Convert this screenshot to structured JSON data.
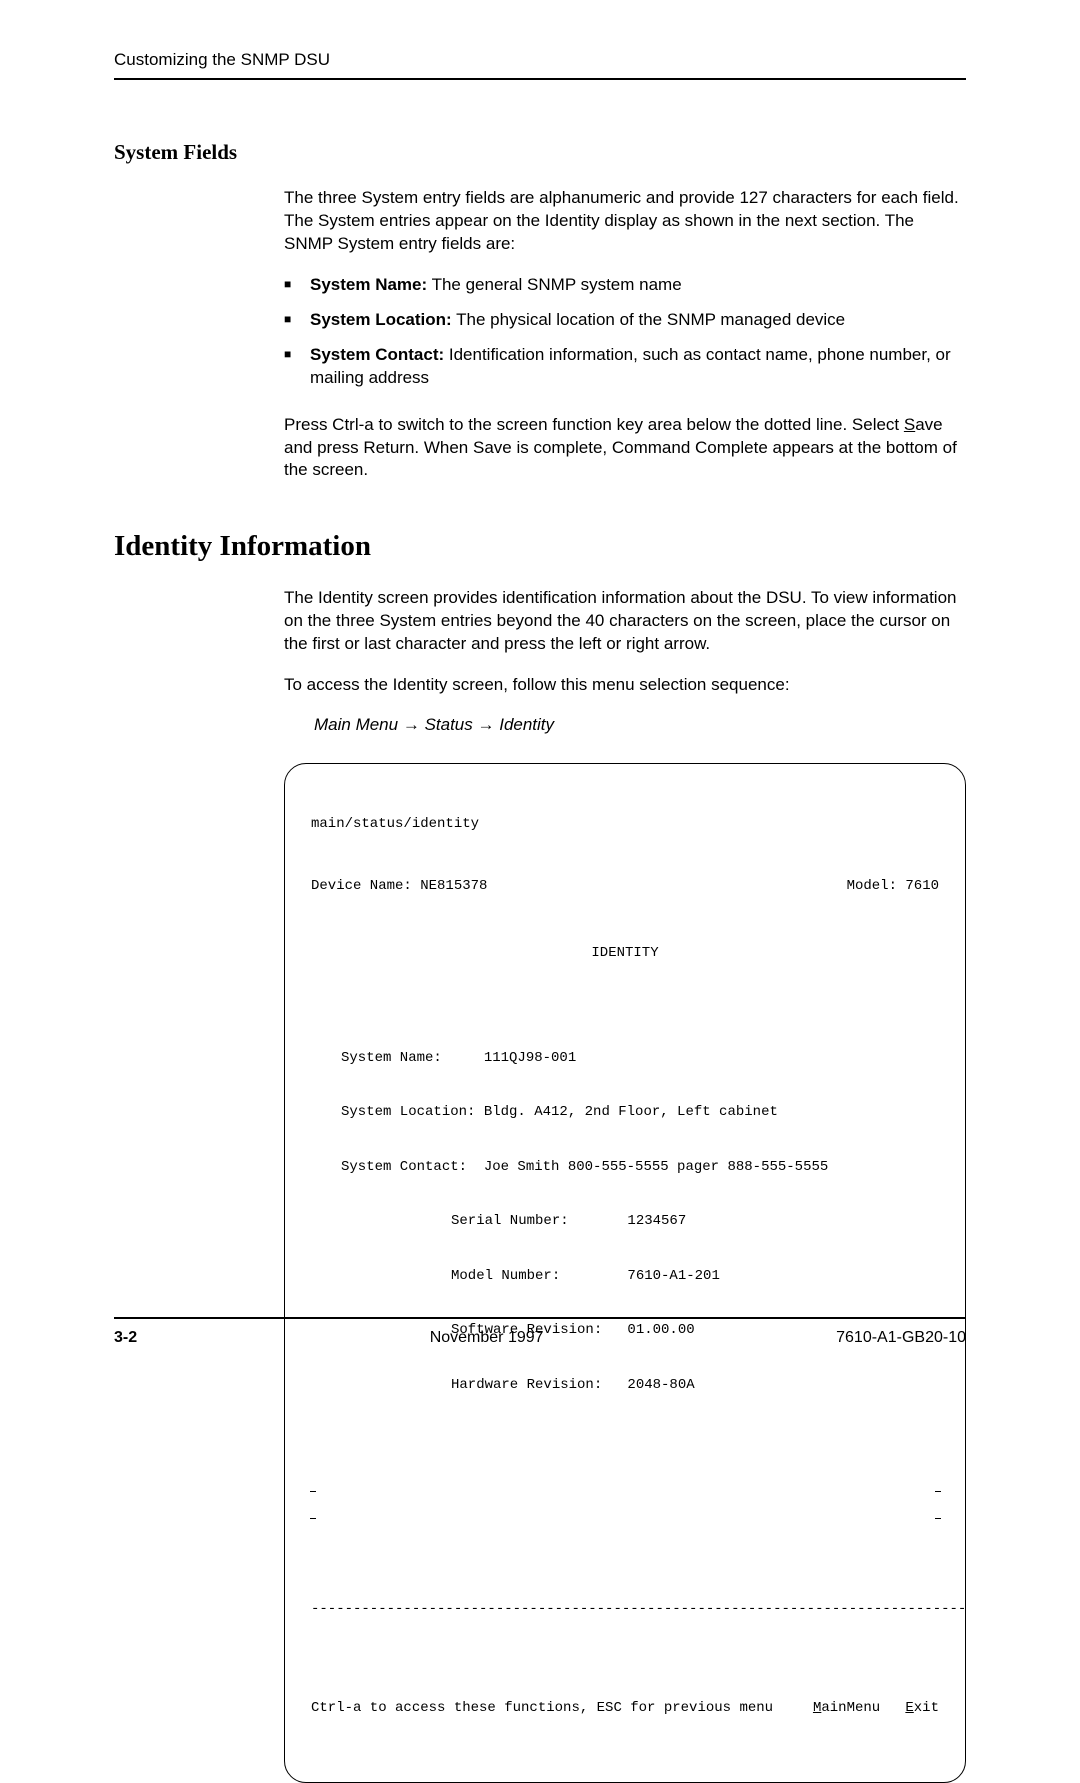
{
  "header": "Customizing the SNMP DSU",
  "section1": {
    "title": "System Fields",
    "intro": "The three System entry fields are alphanumeric and provide 127 characters for each field. The System entries appear on the Identity display as shown in the next section. The SNMP System entry fields are:",
    "bullets": [
      {
        "bold": "System Name:",
        "rest": " The general SNMP system name"
      },
      {
        "bold": "System Location:",
        "rest": " The physical location of the SNMP managed device"
      },
      {
        "bold": "System Contact:",
        "rest": " Identification information, such as contact name, phone number, or mailing address"
      }
    ],
    "after_pre": "Press Ctrl-a to switch to the screen function key area below the dotted line. Select ",
    "after_underline": "S",
    "after_post": "ave and press Return. When Save is complete, Command Complete appears at the bottom of the screen."
  },
  "section2": {
    "title": "Identity Information",
    "p1": "The Identity screen provides identification information about the DSU. To view information on the three System entries beyond the 40 characters on the screen, place the cursor on the first or last character and press the left or right arrow.",
    "p2": "To access the Identity screen, follow this menu selection sequence:",
    "path": {
      "a": "Main Menu ",
      "b": "Status ",
      "c": "Identity"
    }
  },
  "terminal": {
    "breadcrumb": "main/status/identity",
    "device_name": "Device Name: NE815378",
    "model": "Model: 7610",
    "title": "IDENTITY",
    "sys_name": "System Name:     111QJ98-001",
    "sys_loc": "System Location: Bldg. A412, 2nd Floor, Left cabinet",
    "sys_contact": "System Contact:  Joe Smith 800-555-5555 pager 888-555-5555",
    "serial": "Serial Number:       1234567",
    "modelno": "Model Number:        7610-A1-201",
    "swrev": "Software Revision:   01.00.00",
    "hwrev": "Hardware Revision:   2048-80A",
    "divider": "---------------------------------------------------------------------------------",
    "bottom_text": "Ctrl-a to access these functions, ESC for previous menu",
    "bottom_menu_m": "M",
    "bottom_menu_rest": "ainMenu   ",
    "bottom_exit_e": "E",
    "bottom_exit_rest": "xit"
  },
  "footer": {
    "left": "3-2",
    "center": "November 1997",
    "right": "7610-A1-GB20-10"
  }
}
